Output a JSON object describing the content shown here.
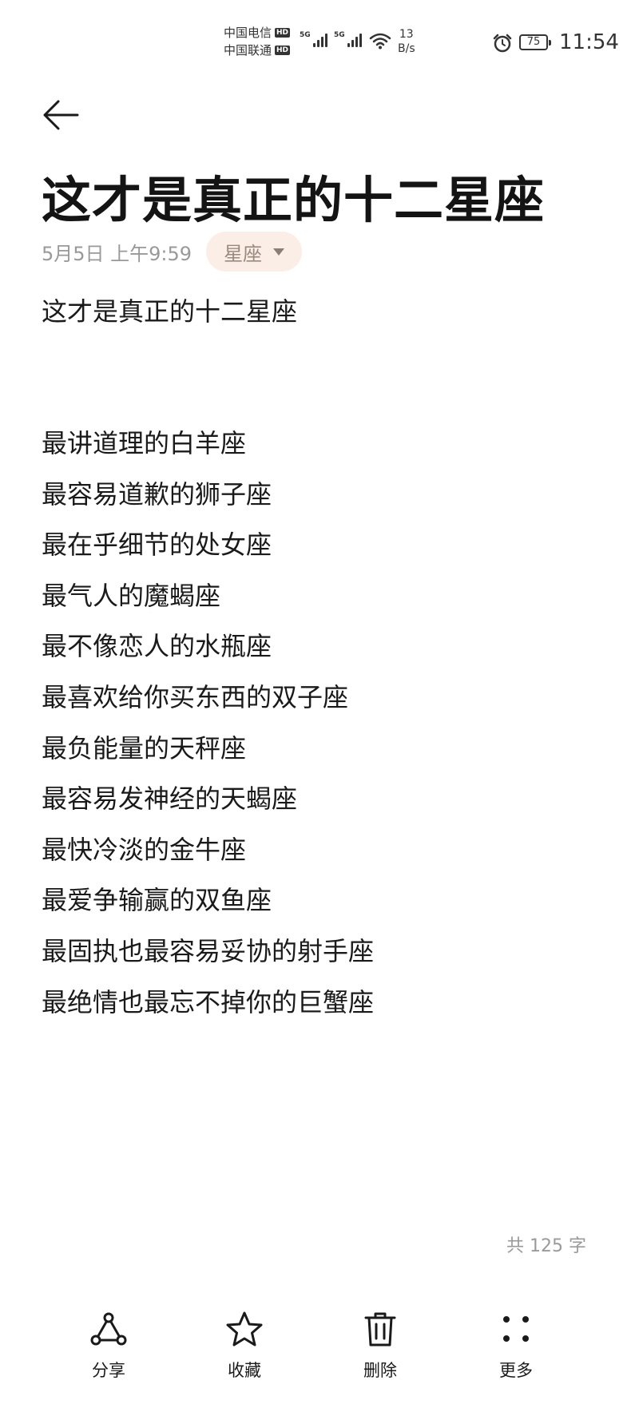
{
  "status_bar": {
    "carrier1": "中国电信",
    "carrier2": "中国联通",
    "hd_badge": "HD",
    "network_type": "5G",
    "net_speed_value": "13",
    "net_speed_unit": "B/s",
    "battery_level": "75",
    "time": "11:54",
    "icons": [
      "signal-icon",
      "wifi-icon",
      "alarm-icon",
      "battery-icon"
    ]
  },
  "header": {
    "title": "这才是真正的十二星座",
    "date": "5月5日 上午9:59",
    "category": "星座"
  },
  "body": {
    "heading": "这才是真正的十二星座",
    "lines": [
      "最讲道理的白羊座",
      "最容易道歉的狮子座",
      "最在乎细节的处女座",
      "最气人的魔蝎座",
      "最不像恋人的水瓶座",
      "最喜欢给你买东西的双子座",
      "最负能量的天秤座",
      "最容易发神经的天蝎座",
      "最快冷淡的金牛座",
      "最爱争输赢的双鱼座",
      "最固执也最容易妥协的射手座",
      "最绝情也最忘不掉你的巨蟹座"
    ]
  },
  "word_count": "共 125 字",
  "toolbar": {
    "share_label": "分享",
    "favorite_label": "收藏",
    "delete_label": "删除",
    "more_label": "更多"
  }
}
